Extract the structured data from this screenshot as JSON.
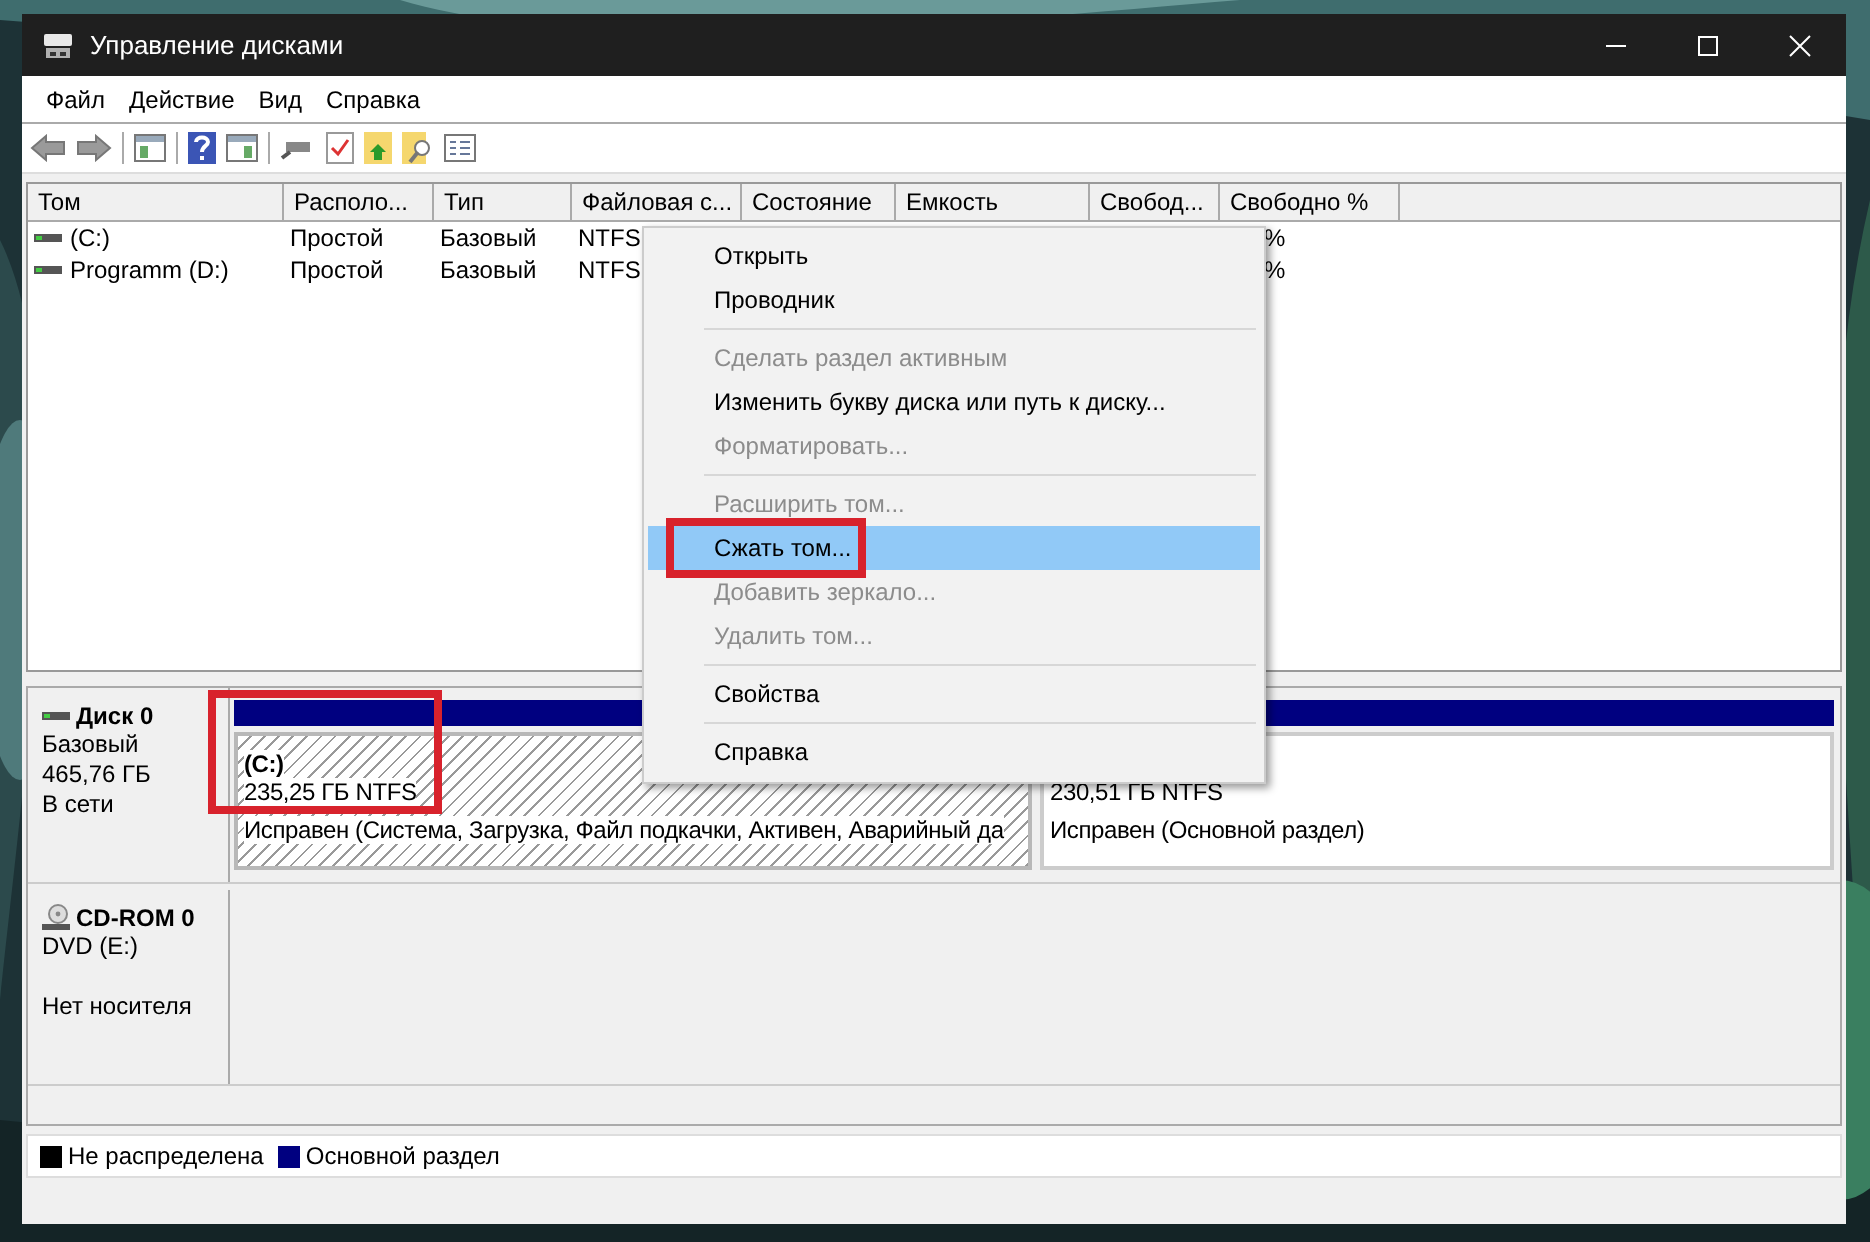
{
  "window": {
    "title": "Управление дисками"
  },
  "menu_bar": [
    "Файл",
    "Действие",
    "Вид",
    "Справка"
  ],
  "table": {
    "columns": [
      "Том",
      "Располо...",
      "Тип",
      "Файловая с...",
      "Состояние",
      "Емкость",
      "Свобод...",
      "Свободно %"
    ],
    "rows": [
      {
        "volume": "(C:)",
        "layout": "Простой",
        "type": "Базовый",
        "file_system": "NTFS",
        "free_percent": "%"
      },
      {
        "volume": "Programm (D:)",
        "layout": "Простой",
        "type": "Базовый",
        "file_system": "NTFS",
        "free_percent": "%"
      }
    ]
  },
  "disks": [
    {
      "kind": "disk",
      "name": "Диск 0",
      "type": "Базовый",
      "size": "465,76 ГБ",
      "status": "В сети",
      "partitions": [
        {
          "name": "(C:)",
          "size": "235,25 ГБ NTFS",
          "status": "Исправен (Система, Загрузка, Файл подкачки, Активен, Аварийный да",
          "selected": true,
          "color": "#000080"
        },
        {
          "size": "230,51 ГБ NTFS",
          "status": "Исправен (Основной раздел)",
          "selected": false,
          "color": "#000080"
        }
      ]
    },
    {
      "kind": "cdrom",
      "name": "CD-ROM 0",
      "type": "DVD (E:)",
      "status": "Нет носителя"
    }
  ],
  "legend": [
    {
      "label": "Не распределена",
      "color": "#000000"
    },
    {
      "label": "Основной раздел",
      "color": "#000080"
    }
  ],
  "context_menu": [
    {
      "kind": "item",
      "label": "Открыть",
      "disabled": false,
      "selected": false
    },
    {
      "kind": "item",
      "label": "Проводник",
      "disabled": false,
      "selected": false
    },
    {
      "kind": "separator"
    },
    {
      "kind": "item",
      "label": "Сделать раздел активным",
      "disabled": true,
      "selected": false
    },
    {
      "kind": "item",
      "label": "Изменить букву диска или путь к диску...",
      "disabled": false,
      "selected": false
    },
    {
      "kind": "item",
      "label": "Форматировать...",
      "disabled": true,
      "selected": false
    },
    {
      "kind": "separator"
    },
    {
      "kind": "item",
      "label": "Расширить том...",
      "disabled": true,
      "selected": false
    },
    {
      "kind": "item",
      "label": "Сжать том...",
      "disabled": false,
      "selected": true
    },
    {
      "kind": "item",
      "label": "Добавить зеркало...",
      "disabled": true,
      "selected": false
    },
    {
      "kind": "item",
      "label": "Удалить том...",
      "disabled": true,
      "selected": false
    },
    {
      "kind": "separator"
    },
    {
      "kind": "item",
      "label": "Свойства",
      "disabled": false,
      "selected": false
    },
    {
      "kind": "separator"
    },
    {
      "kind": "item",
      "label": "Справка",
      "disabled": false,
      "selected": false
    }
  ]
}
